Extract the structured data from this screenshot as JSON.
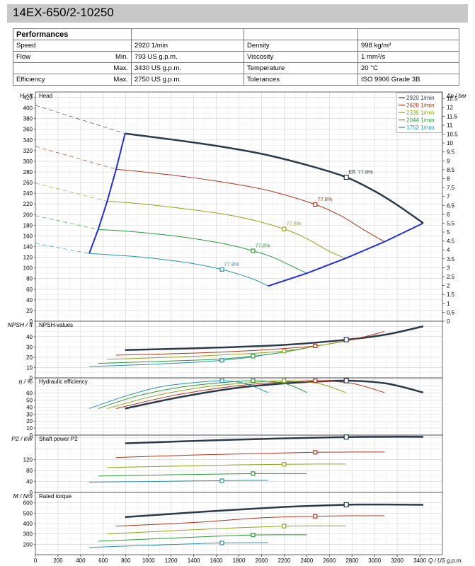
{
  "title": "14EX-650/2-10250",
  "performances": {
    "heading": "Performances",
    "rows": [
      {
        "label": "Speed",
        "sub": "",
        "value": "2920 1/min",
        "label2": "Density",
        "value2": "998 kg/m³"
      },
      {
        "label": "Flow",
        "sub": "Min.",
        "value": "793 US g.p.m.",
        "label2": "Viscosity",
        "value2": "1 mm²/s"
      },
      {
        "label": "",
        "sub": "Max.",
        "value": "3430 US g.p.m.",
        "label2": "Temperature",
        "value2": "20 °C"
      },
      {
        "label": "Efficiency",
        "sub": "Max.",
        "value": "2750 US g.p.m.",
        "label2": "Tolerances",
        "value2": "ISO 9906 Grade 3B"
      }
    ]
  },
  "chart_data": [
    {
      "type": "line",
      "title": "Head",
      "ylabel": "H / ft",
      "ylabel2": "Δp / bar",
      "xlabel": "Q / US g.p.m.",
      "xlim": [
        0,
        3600
      ],
      "ylim": [
        0,
        430
      ],
      "y_ticks": [
        0,
        20,
        40,
        60,
        80,
        100,
        120,
        140,
        160,
        180,
        200,
        220,
        240,
        260,
        280,
        300,
        320,
        340,
        360,
        380,
        400,
        420
      ],
      "y2_ticks": [
        "0",
        "0.5",
        "1",
        "1.5",
        "2",
        "2.5",
        "3",
        "3.5",
        "4",
        "4.5",
        "5",
        "5.5",
        "6",
        "6.5",
        "7",
        "7.5",
        "8",
        "8.5",
        "9",
        "9.5",
        "10",
        "10.5",
        "11",
        "11.5",
        "12",
        "12.5"
      ],
      "legend": [
        "2920 1/min",
        "2628 1/min",
        "2336 1/min",
        "2044 1/min",
        "1752 1/min"
      ],
      "legend_position": "top-right",
      "series": [
        {
          "name": "2920 1/min",
          "color": "#2b3a4a",
          "x": [
            793,
            1200,
            1600,
            2000,
            2400,
            2750,
            3000,
            3200,
            3430
          ],
          "y": [
            352,
            341,
            329,
            314,
            293,
            270,
            244,
            218,
            184
          ],
          "width": 2.5
        },
        {
          "name": "2628 1/min",
          "color": "#b0341c",
          "x": [
            714,
            1000,
            1400,
            1800,
            2100,
            2475,
            2700,
            2900,
            3087
          ],
          "y": [
            285,
            279,
            269,
            256,
            243,
            219,
            198,
            172,
            149
          ],
          "width": 1
        },
        {
          "name": "2336 1/min",
          "color": "#8ea418",
          "x": [
            635,
            900,
            1200,
            1600,
            1900,
            2200,
            2400,
            2600,
            2744
          ],
          "y": [
            225,
            221,
            214,
            203,
            191,
            173,
            155,
            131,
            118
          ],
          "width": 1
        },
        {
          "name": "2044 1/min",
          "color": "#2a9a3a",
          "x": [
            555,
            800,
            1100,
            1400,
            1700,
            1925,
            2100,
            2300,
            2401
          ],
          "y": [
            172,
            169,
            163,
            155,
            144,
            132,
            120,
            100,
            90
          ],
          "width": 1
        },
        {
          "name": "1752 1/min",
          "color": "#2592b0",
          "x": [
            476,
            700,
            950,
            1200,
            1450,
            1650,
            1800,
            1950,
            2058
          ],
          "y": [
            127,
            124,
            120,
            114,
            106,
            97,
            88,
            77,
            66
          ],
          "width": 1
        }
      ],
      "dashed_extension": [
        {
          "color": "#2b3a4a",
          "x": [
            0,
            793
          ],
          "y": [
            405,
            352
          ]
        },
        {
          "color": "#b0341c",
          "x": [
            0,
            714
          ],
          "y": [
            328,
            285
          ]
        },
        {
          "color": "#8ea418",
          "x": [
            0,
            635
          ],
          "y": [
            259,
            225
          ]
        },
        {
          "color": "#2a9a3a",
          "x": [
            0,
            555
          ],
          "y": [
            198,
            172
          ]
        },
        {
          "color": "#2592b0",
          "x": [
            0,
            476
          ],
          "y": [
            146,
            127
          ]
        }
      ],
      "operating_limits": [
        {
          "color": "#1f2fe0",
          "x": [
            476,
            555,
            635,
            714,
            793
          ],
          "y": [
            127,
            172,
            225,
            285,
            352
          ]
        },
        {
          "color": "#1f2fe0",
          "x": [
            2058,
            2401,
            2744,
            3087,
            3430
          ],
          "y": [
            66,
            90,
            118,
            149,
            184
          ]
        }
      ],
      "markers": [
        {
          "x": 2750,
          "y": 270,
          "label": "Eff.  77.8%",
          "color": "#2b3a4a",
          "size": 6
        },
        {
          "x": 2475,
          "y": 219,
          "label": "77.8%",
          "color": "#b0341c",
          "size": 5
        },
        {
          "x": 2200,
          "y": 173,
          "label": "77.8%",
          "color": "#8ea418",
          "size": 5
        },
        {
          "x": 1925,
          "y": 132,
          "label": "77.8%",
          "color": "#2a9a3a",
          "size": 5
        },
        {
          "x": 1650,
          "y": 97,
          "label": "77.8%",
          "color": "#2592b0",
          "size": 5
        }
      ]
    },
    {
      "type": "line",
      "title": "NPSH-values",
      "ylabel": "NPSH / ft",
      "xlim": [
        0,
        3600
      ],
      "ylim": [
        0,
        55
      ],
      "y_ticks": [
        0,
        10,
        20,
        30,
        40
      ],
      "series": [
        {
          "name": "2920 1/min",
          "color": "#2b3a4a",
          "x": [
            793,
            1500,
            2200,
            2750,
            3100,
            3430
          ],
          "y": [
            27,
            29,
            32,
            37,
            42,
            50
          ],
          "width": 2.5
        },
        {
          "name": "2628 1/min",
          "color": "#b0341c",
          "x": [
            714,
            1400,
            2000,
            2475,
            2800,
            3087
          ],
          "y": [
            22,
            24,
            27,
            31,
            37,
            45
          ],
          "width": 1
        },
        {
          "name": "2336 1/min",
          "color": "#8ea418",
          "x": [
            635,
            1200,
            1800,
            2200,
            2500,
            2744
          ],
          "y": [
            18,
            20,
            23,
            26,
            31,
            36
          ],
          "width": 1
        },
        {
          "name": "2044 1/min",
          "color": "#2a9a3a",
          "x": [
            555,
            1100,
            1600,
            1925,
            2200,
            2401
          ],
          "y": [
            14,
            16,
            18,
            21,
            25,
            29
          ],
          "width": 1
        },
        {
          "name": "1752 1/min",
          "color": "#2592b0",
          "x": [
            476,
            1000,
            1400,
            1650,
            1900,
            2058
          ],
          "y": [
            11,
            13,
            15,
            17,
            20,
            23
          ],
          "width": 1
        }
      ],
      "markers": [
        {
          "x": 2750,
          "y": 37,
          "color": "#2b3a4a",
          "size": 6
        },
        {
          "x": 2475,
          "y": 31,
          "color": "#b0341c",
          "size": 5
        },
        {
          "x": 2200,
          "y": 26,
          "color": "#8ea418",
          "size": 5
        },
        {
          "x": 1925,
          "y": 21,
          "color": "#2a9a3a",
          "size": 5
        },
        {
          "x": 1650,
          "y": 17,
          "color": "#2592b0",
          "size": 5
        }
      ]
    },
    {
      "type": "line",
      "title": "Hydraulic efficiency",
      "ylabel": "η / %",
      "xlim": [
        0,
        3600
      ],
      "ylim": [
        0,
        82
      ],
      "y_ticks": [
        0,
        10,
        20,
        30,
        40,
        50,
        60
      ],
      "series": [
        {
          "name": "2920 1/min",
          "color": "#2b3a4a",
          "x": [
            793,
            1300,
            1800,
            2300,
            2750,
            3100,
            3430
          ],
          "y": [
            38,
            55,
            68,
            75,
            77.8,
            74,
            61
          ],
          "width": 2.5
        },
        {
          "name": "2628 1/min",
          "color": "#b0341c",
          "x": [
            714,
            1200,
            1700,
            2100,
            2475,
            2800,
            3087
          ],
          "y": [
            38,
            56,
            69,
            75,
            77.8,
            74,
            61
          ],
          "width": 1
        },
        {
          "name": "2336 1/min",
          "color": "#8ea418",
          "x": [
            635,
            1050,
            1500,
            1900,
            2200,
            2500,
            2744
          ],
          "y": [
            38,
            56,
            69,
            75,
            77.8,
            74,
            61
          ],
          "width": 1
        },
        {
          "name": "2044 1/min",
          "color": "#2a9a3a",
          "x": [
            555,
            900,
            1300,
            1650,
            1925,
            2200,
            2401
          ],
          "y": [
            38,
            56,
            69,
            75,
            77.8,
            74,
            61
          ],
          "width": 1
        },
        {
          "name": "1752 1/min",
          "color": "#2592b0",
          "x": [
            476,
            800,
            1100,
            1400,
            1650,
            1850,
            2058
          ],
          "y": [
            38,
            56,
            69,
            75,
            77.8,
            74,
            61
          ],
          "width": 1
        }
      ],
      "markers": [
        {
          "x": 2750,
          "y": 77.8,
          "color": "#2b3a4a",
          "size": 6
        },
        {
          "x": 2475,
          "y": 77.8,
          "color": "#b0341c",
          "size": 5
        },
        {
          "x": 2200,
          "y": 77.8,
          "color": "#8ea418",
          "size": 5
        },
        {
          "x": 1925,
          "y": 77.8,
          "color": "#2a9a3a",
          "size": 5
        },
        {
          "x": 1650,
          "y": 77.8,
          "color": "#2592b0",
          "size": 5
        }
      ]
    },
    {
      "type": "line",
      "title": "Shaft power P2",
      "ylabel": "P2 / kW",
      "xlim": [
        0,
        3600
      ],
      "ylim": [
        0,
        210
      ],
      "y_ticks": [
        0,
        40,
        80,
        120
      ],
      "series": [
        {
          "name": "2920 1/min",
          "color": "#2b3a4a",
          "x": [
            793,
            1500,
            2200,
            2750,
            3100,
            3430
          ],
          "y": [
            180,
            190,
            198,
            203,
            204,
            204
          ],
          "width": 2.5
        },
        {
          "name": "2628 1/min",
          "color": "#b0341c",
          "x": [
            714,
            1400,
            2000,
            2475,
            2800,
            3087
          ],
          "y": [
            128,
            137,
            143,
            147,
            148,
            148
          ],
          "width": 1
        },
        {
          "name": "2336 1/min",
          "color": "#8ea418",
          "x": [
            635,
            1200,
            1800,
            2200,
            2500,
            2744
          ],
          "y": [
            91,
            96,
            101,
            103,
            104,
            104
          ],
          "width": 1
        },
        {
          "name": "2044 1/min",
          "color": "#2a9a3a",
          "x": [
            555,
            1100,
            1600,
            1925,
            2200,
            2401
          ],
          "y": [
            60,
            64,
            67,
            69,
            69,
            69
          ],
          "width": 1
        },
        {
          "name": "1752 1/min",
          "color": "#2592b0",
          "x": [
            476,
            1000,
            1400,
            1650,
            1900,
            2058
          ],
          "y": [
            38,
            40,
            42,
            43,
            44,
            44
          ],
          "width": 1
        }
      ],
      "markers": [
        {
          "x": 2750,
          "y": 203,
          "color": "#2b3a4a",
          "size": 6
        },
        {
          "x": 2475,
          "y": 147,
          "color": "#b0341c",
          "size": 5
        },
        {
          "x": 2200,
          "y": 103,
          "color": "#8ea418",
          "size": 5
        },
        {
          "x": 1925,
          "y": 69,
          "color": "#2a9a3a",
          "size": 5
        },
        {
          "x": 1650,
          "y": 43,
          "color": "#2592b0",
          "size": 5
        }
      ]
    },
    {
      "type": "line",
      "title": "Rated torque",
      "ylabel": "M / Nm",
      "xlabel": "Q / US g.p.m.",
      "xlim": [
        0,
        3600
      ],
      "ylim": [
        100,
        700
      ],
      "y_ticks": [
        200,
        300,
        400,
        500,
        600
      ],
      "x_ticks": [
        0,
        200,
        400,
        600,
        800,
        1000,
        1200,
        1400,
        1600,
        1800,
        2000,
        2200,
        2400,
        2600,
        2800,
        3000,
        3200,
        3400
      ],
      "series": [
        {
          "name": "2920 1/min",
          "color": "#2b3a4a",
          "x": [
            793,
            1500,
            2200,
            2750,
            3100,
            3430
          ],
          "y": [
            462,
            515,
            560,
            581,
            583,
            581
          ],
          "width": 2.5
        },
        {
          "name": "2628 1/min",
          "color": "#b0341c",
          "x": [
            714,
            1400,
            2000,
            2475,
            2800,
            3087
          ],
          "y": [
            375,
            410,
            455,
            470,
            475,
            475
          ],
          "width": 1
        },
        {
          "name": "2336 1/min",
          "color": "#8ea418",
          "x": [
            635,
            1200,
            1800,
            2200,
            2500,
            2744
          ],
          "y": [
            300,
            330,
            360,
            375,
            378,
            378
          ],
          "width": 1
        },
        {
          "name": "2044 1/min",
          "color": "#2a9a3a",
          "x": [
            555,
            1100,
            1600,
            1925,
            2200,
            2401
          ],
          "y": [
            230,
            255,
            278,
            290,
            292,
            292
          ],
          "width": 1
        },
        {
          "name": "1752 1/min",
          "color": "#2592b0",
          "x": [
            476,
            1000,
            1400,
            1650,
            1900,
            2058
          ],
          "y": [
            170,
            190,
            205,
            213,
            215,
            215
          ],
          "width": 1
        }
      ],
      "markers": [
        {
          "x": 2750,
          "y": 581,
          "color": "#2b3a4a",
          "size": 6
        },
        {
          "x": 2475,
          "y": 470,
          "color": "#b0341c",
          "size": 5
        },
        {
          "x": 2200,
          "y": 375,
          "color": "#8ea418",
          "size": 5
        },
        {
          "x": 1925,
          "y": 290,
          "color": "#2a9a3a",
          "size": 5
        },
        {
          "x": 1650,
          "y": 213,
          "color": "#2592b0",
          "size": 5
        }
      ]
    }
  ]
}
